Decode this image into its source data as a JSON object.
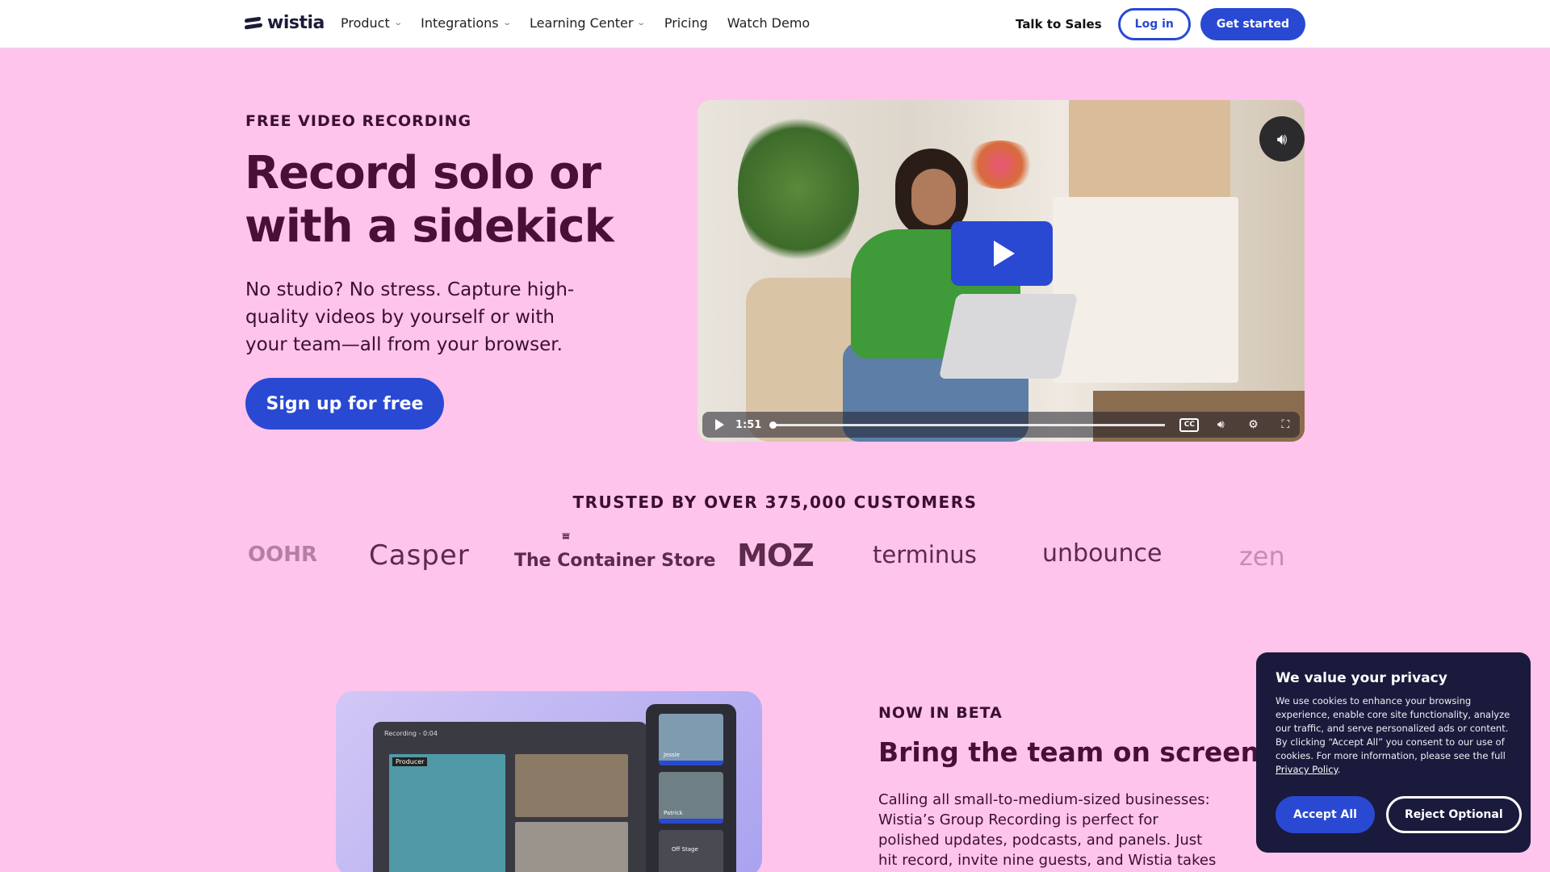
{
  "nav": {
    "logo_text": "wistia",
    "links": [
      {
        "label": "Product",
        "dropdown": true
      },
      {
        "label": "Integrations",
        "dropdown": true
      },
      {
        "label": "Learning Center",
        "dropdown": true
      },
      {
        "label": "Pricing",
        "dropdown": false
      },
      {
        "label": "Watch Demo",
        "dropdown": false
      }
    ],
    "talk_to_sales": "Talk to Sales",
    "login": "Log in",
    "get_started": "Get started"
  },
  "hero": {
    "eyebrow": "FREE VIDEO RECORDING",
    "title": "Record solo or with a sidekick",
    "subtitle": "No studio? No stress. Capture high-quality videos by yourself or with your team—all from your browser.",
    "cta": "Sign up for free"
  },
  "video": {
    "duration": "1:51",
    "progress": 0,
    "cc_label": "CC"
  },
  "trusted": {
    "heading": "TRUSTED BY OVER 375,000 CUSTOMERS",
    "brands": [
      "OOHR",
      "Casper",
      "The Container Store",
      "MOZ",
      "terminus",
      "unbounce",
      "zen"
    ]
  },
  "feature": {
    "eyebrow": "NOW IN BETA",
    "title": "Bring the team on screen",
    "body": "Calling all small-to-medium-sized businesses: Wistia’s Group Recording is perfect for polished updates, podcasts, and panels. Just hit record, invite nine guests, and Wistia takes care of the",
    "mock": {
      "recording_label": "Recording - 0:04",
      "producer_label": "Producer",
      "participants": [
        "Jessie",
        "Patrick"
      ],
      "off_stage": "Off Stage"
    }
  },
  "cookie": {
    "title": "We value your privacy",
    "body": "We use cookies to enhance your browsing experience, enable core site functionality, analyze our traffic, and serve personalized ads or content. By clicking “Accept All” you consent to our use of cookies. For more information, please see the full",
    "link": "Privacy Policy",
    "accept": "Accept All",
    "reject": "Reject Optional"
  },
  "colors": {
    "background": "#ffc4ec",
    "accent": "#2949d3",
    "heading": "#4a0f37",
    "cookie_bg": "#1a1a3c"
  }
}
